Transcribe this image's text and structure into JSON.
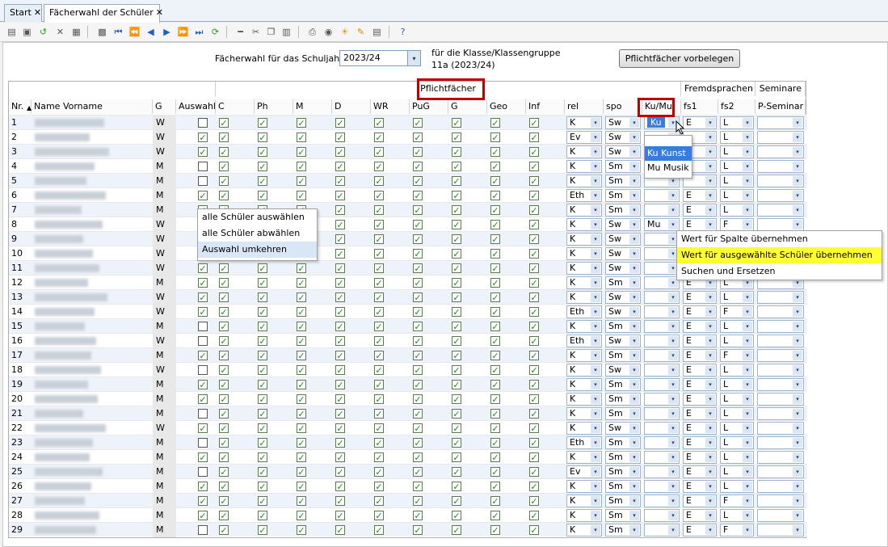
{
  "tabs": [
    {
      "label": "Start",
      "close": "✕"
    },
    {
      "label": "Fächerwahl der Schüler",
      "close": "✕"
    }
  ],
  "toolbar_icons": [
    "new-doc-icon",
    "save-icon",
    "undo-icon",
    "delete-icon",
    "report-icon",
    "copy-icon",
    "first-icon",
    "prev-page-icon",
    "prev-icon",
    "next-icon",
    "next-page-icon",
    "last-icon",
    "refresh-icon",
    "remove-icon",
    "cut-icon",
    "duplicate-icon",
    "paste-icon",
    "print-icon",
    "preview-icon",
    "lightbulb-icon",
    "brush-icon",
    "export-icon",
    "help-icon"
  ],
  "top": {
    "schuljahr_label": "Fächerwahl für das Schuljahr",
    "schuljahr_value": "2023/24",
    "klasse_label": "für die Klasse/Klassengruppe",
    "klasse_value": "11a (2023/24)",
    "pflicht_button": "Pflichtfächer vorbelegen"
  },
  "groups": {
    "pflicht": "Pflichtfächer",
    "fremd": "Fremdsprachen",
    "seminare": "Seminare"
  },
  "columns": [
    "Nr.",
    "Name Vorname",
    "G",
    "Auswahl",
    "C",
    "Ph",
    "M",
    "D",
    "WR",
    "PuG",
    "G",
    "Geo",
    "Inf",
    "rel",
    "spo",
    "Ku/Mu",
    "fs1",
    "fs2",
    "P-Seminar"
  ],
  "rows": [
    {
      "nr": "1",
      "g": "W",
      "aus": false,
      "c": true,
      "ph": true,
      "m": true,
      "d": true,
      "wr": true,
      "pug": true,
      "gg": true,
      "geo": true,
      "inf": true,
      "rel": "K",
      "spo": "Sw",
      "kumu": "Ku",
      "fs1": "E",
      "fs2": "L"
    },
    {
      "nr": "2",
      "g": "W",
      "aus": true,
      "c": true,
      "ph": true,
      "m": true,
      "d": true,
      "wr": true,
      "pug": true,
      "gg": true,
      "geo": true,
      "inf": true,
      "rel": "Ev",
      "spo": "Sw",
      "kumu": "",
      "fs1": "",
      "fs2": "L"
    },
    {
      "nr": "3",
      "g": "W",
      "aus": true,
      "c": true,
      "ph": true,
      "m": true,
      "d": true,
      "wr": true,
      "pug": true,
      "gg": true,
      "geo": true,
      "inf": true,
      "rel": "K",
      "spo": "Sw",
      "kumu": "",
      "fs1": "",
      "fs2": "L"
    },
    {
      "nr": "4",
      "g": "M",
      "aus": false,
      "c": true,
      "ph": true,
      "m": true,
      "d": true,
      "wr": true,
      "pug": true,
      "gg": true,
      "geo": true,
      "inf": true,
      "rel": "K",
      "spo": "Sm",
      "kumu": "",
      "fs1": "",
      "fs2": "L"
    },
    {
      "nr": "5",
      "g": "M",
      "aus": false,
      "c": true,
      "ph": true,
      "m": true,
      "d": true,
      "wr": true,
      "pug": true,
      "gg": true,
      "geo": true,
      "inf": true,
      "rel": "K",
      "spo": "Sm",
      "kumu": "",
      "fs1": "",
      "fs2": "L"
    },
    {
      "nr": "6",
      "g": "M",
      "aus": true,
      "c": true,
      "ph": true,
      "m": true,
      "d": true,
      "wr": true,
      "pug": true,
      "gg": true,
      "geo": true,
      "inf": true,
      "rel": "Eth",
      "spo": "Sm",
      "kumu": "",
      "fs1": "E",
      "fs2": "L"
    },
    {
      "nr": "7",
      "g": "M",
      "aus": true,
      "c": true,
      "ph": true,
      "m": true,
      "d": true,
      "wr": true,
      "pug": true,
      "gg": true,
      "geo": true,
      "inf": true,
      "rel": "K",
      "spo": "Sm",
      "kumu": "",
      "fs1": "E",
      "fs2": "L"
    },
    {
      "nr": "8",
      "g": "W",
      "aus": true,
      "c": true,
      "ph": true,
      "m": true,
      "d": true,
      "wr": true,
      "pug": true,
      "gg": true,
      "geo": true,
      "inf": true,
      "rel": "K",
      "spo": "Sw",
      "kumu": "Mu",
      "fs1": "E",
      "fs2": "F"
    },
    {
      "nr": "9",
      "g": "W",
      "aus": false,
      "c": true,
      "ph": true,
      "m": true,
      "d": true,
      "wr": true,
      "pug": true,
      "gg": true,
      "geo": true,
      "inf": true,
      "rel": "K",
      "spo": "Sw",
      "kumu": "",
      "fs1": "",
      "fs2": ""
    },
    {
      "nr": "10",
      "g": "W",
      "aus": false,
      "c": true,
      "ph": true,
      "m": true,
      "d": true,
      "wr": true,
      "pug": true,
      "gg": true,
      "geo": true,
      "inf": true,
      "rel": "K",
      "spo": "Sw",
      "kumu": "",
      "fs1": "",
      "fs2": ""
    },
    {
      "nr": "11",
      "g": "W",
      "aus": true,
      "c": true,
      "ph": true,
      "m": true,
      "d": true,
      "wr": true,
      "pug": true,
      "gg": true,
      "geo": true,
      "inf": true,
      "rel": "K",
      "spo": "Sw",
      "kumu": "",
      "fs1": "",
      "fs2": ""
    },
    {
      "nr": "12",
      "g": "M",
      "aus": true,
      "c": true,
      "ph": true,
      "m": true,
      "d": true,
      "wr": true,
      "pug": true,
      "gg": true,
      "geo": true,
      "inf": true,
      "rel": "K",
      "spo": "Sm",
      "kumu": "",
      "fs1": "E",
      "fs2": "L"
    },
    {
      "nr": "13",
      "g": "W",
      "aus": true,
      "c": true,
      "ph": true,
      "m": true,
      "d": true,
      "wr": true,
      "pug": true,
      "gg": true,
      "geo": true,
      "inf": true,
      "rel": "K",
      "spo": "Sw",
      "kumu": "",
      "fs1": "E",
      "fs2": "L"
    },
    {
      "nr": "14",
      "g": "W",
      "aus": true,
      "c": true,
      "ph": true,
      "m": true,
      "d": true,
      "wr": true,
      "pug": true,
      "gg": true,
      "geo": true,
      "inf": true,
      "rel": "Eth",
      "spo": "Sw",
      "kumu": "",
      "fs1": "E",
      "fs2": "F"
    },
    {
      "nr": "15",
      "g": "M",
      "aus": false,
      "c": true,
      "ph": true,
      "m": true,
      "d": true,
      "wr": true,
      "pug": true,
      "gg": true,
      "geo": true,
      "inf": true,
      "rel": "K",
      "spo": "Sm",
      "kumu": "",
      "fs1": "E",
      "fs2": "L"
    },
    {
      "nr": "16",
      "g": "W",
      "aus": false,
      "c": true,
      "ph": true,
      "m": true,
      "d": true,
      "wr": true,
      "pug": true,
      "gg": true,
      "geo": true,
      "inf": true,
      "rel": "Eth",
      "spo": "Sw",
      "kumu": "",
      "fs1": "E",
      "fs2": "L"
    },
    {
      "nr": "17",
      "g": "M",
      "aus": true,
      "c": true,
      "ph": true,
      "m": true,
      "d": true,
      "wr": true,
      "pug": true,
      "gg": true,
      "geo": true,
      "inf": true,
      "rel": "K",
      "spo": "Sm",
      "kumu": "",
      "fs1": "E",
      "fs2": "F"
    },
    {
      "nr": "18",
      "g": "W",
      "aus": false,
      "c": true,
      "ph": true,
      "m": true,
      "d": true,
      "wr": true,
      "pug": true,
      "gg": true,
      "geo": true,
      "inf": true,
      "rel": "K",
      "spo": "Sw",
      "kumu": "",
      "fs1": "E",
      "fs2": "L"
    },
    {
      "nr": "19",
      "g": "M",
      "aus": true,
      "c": true,
      "ph": true,
      "m": true,
      "d": true,
      "wr": true,
      "pug": true,
      "gg": true,
      "geo": true,
      "inf": true,
      "rel": "K",
      "spo": "Sm",
      "kumu": "",
      "fs1": "E",
      "fs2": "L"
    },
    {
      "nr": "20",
      "g": "M",
      "aus": true,
      "c": true,
      "ph": true,
      "m": true,
      "d": true,
      "wr": true,
      "pug": true,
      "gg": true,
      "geo": true,
      "inf": true,
      "rel": "K",
      "spo": "Sm",
      "kumu": "",
      "fs1": "E",
      "fs2": "L"
    },
    {
      "nr": "21",
      "g": "M",
      "aus": false,
      "c": true,
      "ph": true,
      "m": true,
      "d": true,
      "wr": true,
      "pug": true,
      "gg": true,
      "geo": true,
      "inf": true,
      "rel": "K",
      "spo": "Sm",
      "kumu": "",
      "fs1": "E",
      "fs2": "L"
    },
    {
      "nr": "22",
      "g": "W",
      "aus": true,
      "c": true,
      "ph": true,
      "m": true,
      "d": true,
      "wr": true,
      "pug": true,
      "gg": true,
      "geo": true,
      "inf": true,
      "rel": "K",
      "spo": "Sw",
      "kumu": "",
      "fs1": "E",
      "fs2": "L"
    },
    {
      "nr": "23",
      "g": "M",
      "aus": false,
      "c": true,
      "ph": true,
      "m": true,
      "d": true,
      "wr": true,
      "pug": true,
      "gg": true,
      "geo": true,
      "inf": true,
      "rel": "Eth",
      "spo": "Sm",
      "kumu": "",
      "fs1": "E",
      "fs2": "L"
    },
    {
      "nr": "24",
      "g": "M",
      "aus": true,
      "c": true,
      "ph": true,
      "m": true,
      "d": true,
      "wr": true,
      "pug": true,
      "gg": true,
      "geo": true,
      "inf": true,
      "rel": "K",
      "spo": "Sm",
      "kumu": "",
      "fs1": "E",
      "fs2": "L"
    },
    {
      "nr": "25",
      "g": "M",
      "aus": false,
      "c": true,
      "ph": true,
      "m": true,
      "d": true,
      "wr": true,
      "pug": true,
      "gg": true,
      "geo": true,
      "inf": true,
      "rel": "Ev",
      "spo": "Sm",
      "kumu": "",
      "fs1": "E",
      "fs2": "L"
    },
    {
      "nr": "26",
      "g": "M",
      "aus": true,
      "c": true,
      "ph": true,
      "m": true,
      "d": true,
      "wr": true,
      "pug": true,
      "gg": true,
      "geo": true,
      "inf": true,
      "rel": "K",
      "spo": "Sm",
      "kumu": "",
      "fs1": "E",
      "fs2": "L"
    },
    {
      "nr": "27",
      "g": "M",
      "aus": true,
      "c": true,
      "ph": true,
      "m": true,
      "d": true,
      "wr": true,
      "pug": true,
      "gg": true,
      "geo": true,
      "inf": true,
      "rel": "K",
      "spo": "Sm",
      "kumu": "",
      "fs1": "E",
      "fs2": "F"
    },
    {
      "nr": "28",
      "g": "M",
      "aus": true,
      "c": true,
      "ph": true,
      "m": true,
      "d": true,
      "wr": true,
      "pug": true,
      "gg": true,
      "geo": true,
      "inf": true,
      "rel": "K",
      "spo": "Sm",
      "kumu": "",
      "fs1": "E",
      "fs2": "L"
    },
    {
      "nr": "29",
      "g": "M",
      "aus": false,
      "c": true,
      "ph": true,
      "m": true,
      "d": true,
      "wr": true,
      "pug": true,
      "gg": true,
      "geo": true,
      "inf": true,
      "rel": "K",
      "spo": "Sm",
      "kumu": "",
      "fs1": "E",
      "fs2": "F"
    }
  ],
  "kumu_dropdown": [
    {
      "code": "Ku",
      "label": "Kunst"
    },
    {
      "code": "Mu",
      "label": "Musik"
    }
  ],
  "context_menu_auswahl": [
    "alle Schüler auswählen",
    "alle Schüler abwählen",
    "Auswahl umkehren"
  ],
  "context_menu_wert": [
    "Wert für Spalte übernehmen",
    "Wert für ausgewählte Schüler übernehmen",
    "Suchen und Ersetzen"
  ],
  "check_glyph": "✓",
  "sort_glyph": "▲",
  "dd_glyph": "▾"
}
